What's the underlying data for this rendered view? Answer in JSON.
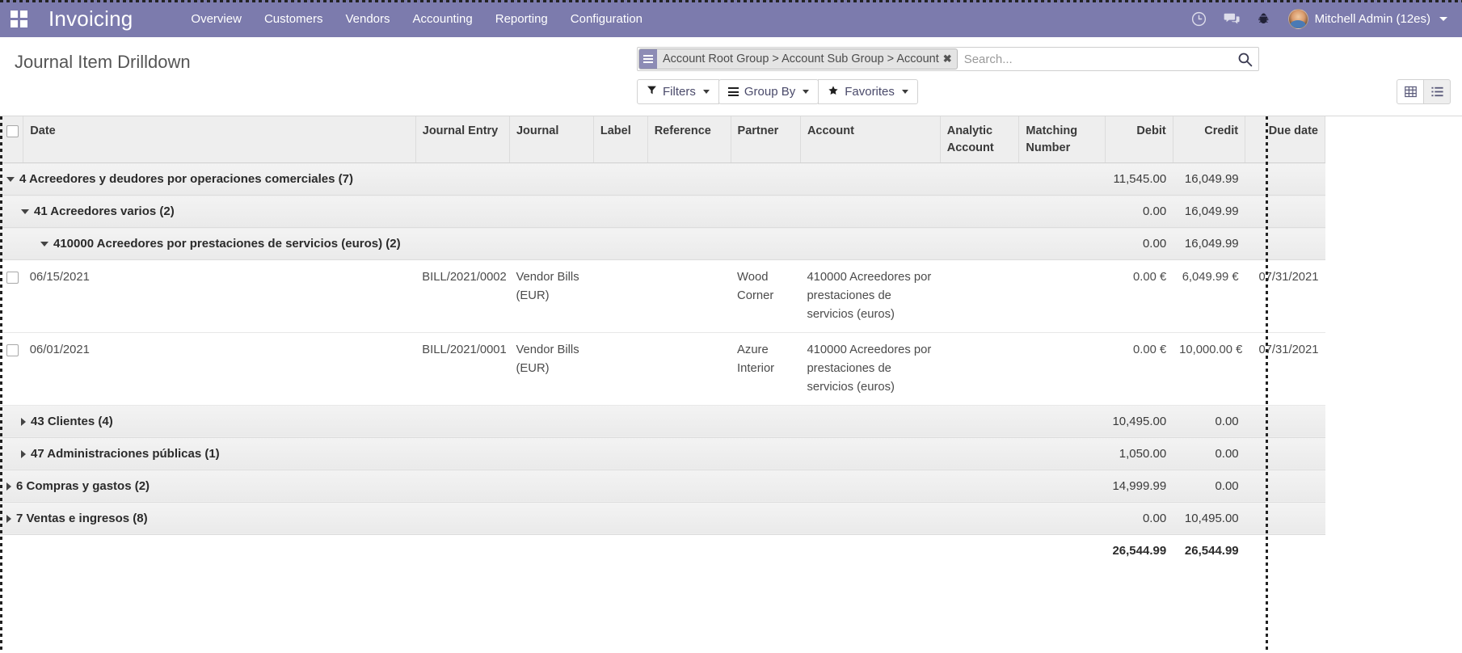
{
  "navbar": {
    "apps_icon": "apps-grid-icon",
    "brand": "Invoicing",
    "menu": [
      {
        "label": "Overview"
      },
      {
        "label": "Customers"
      },
      {
        "label": "Vendors"
      },
      {
        "label": "Accounting"
      },
      {
        "label": "Reporting"
      },
      {
        "label": "Configuration"
      }
    ],
    "icons": [
      {
        "name": "clock-icon"
      },
      {
        "name": "chat-bubble-icon"
      },
      {
        "name": "bug-icon"
      }
    ],
    "user": "Mitchell Admin (12es)",
    "brand_color": "#7C7BAD"
  },
  "control_panel": {
    "title": "Journal Item Drilldown",
    "facet": {
      "icon": "group-by-lines-icon",
      "label": "Account Root Group > Account Sub Group > Account",
      "close": "✖"
    },
    "search": {
      "placeholder": "Search...",
      "value": ""
    },
    "buttons": [
      {
        "name": "filters",
        "label": "Filters",
        "icon": "funnel-icon"
      },
      {
        "name": "group-by",
        "label": "Group By",
        "icon": "lines-icon"
      },
      {
        "name": "favorites",
        "label": "Favorites",
        "icon": "star-icon"
      }
    ],
    "view_switcher": [
      {
        "name": "pivot-view",
        "icon": "grid-icon",
        "active": false
      },
      {
        "name": "list-view",
        "icon": "list-icon",
        "active": true
      }
    ]
  },
  "table": {
    "columns": [
      {
        "key": "date",
        "label": "Date",
        "align": "left"
      },
      {
        "key": "journal_entry",
        "label": "Journal Entry",
        "align": "left"
      },
      {
        "key": "journal",
        "label": "Journal",
        "align": "left"
      },
      {
        "key": "label",
        "label": "Label",
        "align": "left"
      },
      {
        "key": "reference",
        "label": "Reference",
        "align": "left"
      },
      {
        "key": "partner",
        "label": "Partner",
        "align": "left"
      },
      {
        "key": "account",
        "label": "Account",
        "align": "left"
      },
      {
        "key": "analytic_account",
        "label": "Analytic Account",
        "align": "left"
      },
      {
        "key": "matching_number",
        "label": "Matching Number",
        "align": "left"
      },
      {
        "key": "debit",
        "label": "Debit",
        "align": "right"
      },
      {
        "key": "credit",
        "label": "Credit",
        "align": "right"
      },
      {
        "key": "due_date",
        "label": "Due date",
        "align": "right"
      }
    ],
    "rows": [
      {
        "type": "group",
        "level": 0,
        "expanded": true,
        "label": "4 Acreedores y deudores por operaciones comerciales (7)",
        "debit": "11,545.00",
        "credit": "16,049.99"
      },
      {
        "type": "group",
        "level": 1,
        "expanded": true,
        "label": "41 Acreedores varios (2)",
        "debit": "0.00",
        "credit": "16,049.99"
      },
      {
        "type": "group",
        "level": 2,
        "expanded": true,
        "label": "410000 Acreedores por prestaciones de servicios (euros) (2)",
        "debit": "0.00",
        "credit": "16,049.99"
      },
      {
        "type": "data",
        "date": "06/15/2021",
        "journal_entry": "BILL/2021/0002",
        "journal": "Vendor Bills (EUR)",
        "label": "",
        "reference": "",
        "partner": "Wood Corner",
        "account": "410000 Acreedores por prestaciones de servicios (euros)",
        "analytic_account": "",
        "matching_number": "",
        "debit": "0.00 €",
        "credit": "6,049.99 €",
        "due_date": "07/31/2021"
      },
      {
        "type": "data",
        "date": "06/01/2021",
        "journal_entry": "BILL/2021/0001",
        "journal": "Vendor Bills (EUR)",
        "label": "",
        "reference": "",
        "partner": "Azure Interior",
        "account": "410000 Acreedores por prestaciones de servicios (euros)",
        "analytic_account": "",
        "matching_number": "",
        "debit": "0.00 €",
        "credit": "10,000.00 €",
        "due_date": "07/31/2021"
      },
      {
        "type": "group",
        "level": 1,
        "expanded": false,
        "label": "43 Clientes (4)",
        "debit": "10,495.00",
        "credit": "0.00"
      },
      {
        "type": "group",
        "level": 1,
        "expanded": false,
        "label": "47 Administraciones públicas (1)",
        "debit": "1,050.00",
        "credit": "0.00"
      },
      {
        "type": "group",
        "level": 0,
        "expanded": false,
        "label": "6 Compras y gastos (2)",
        "debit": "14,999.99",
        "credit": "0.00"
      },
      {
        "type": "group",
        "level": 0,
        "expanded": false,
        "label": "7 Ventas e ingresos (8)",
        "debit": "0.00",
        "credit": "10,495.00"
      }
    ],
    "totals": {
      "debit": "26,544.99",
      "credit": "26,544.99"
    }
  }
}
